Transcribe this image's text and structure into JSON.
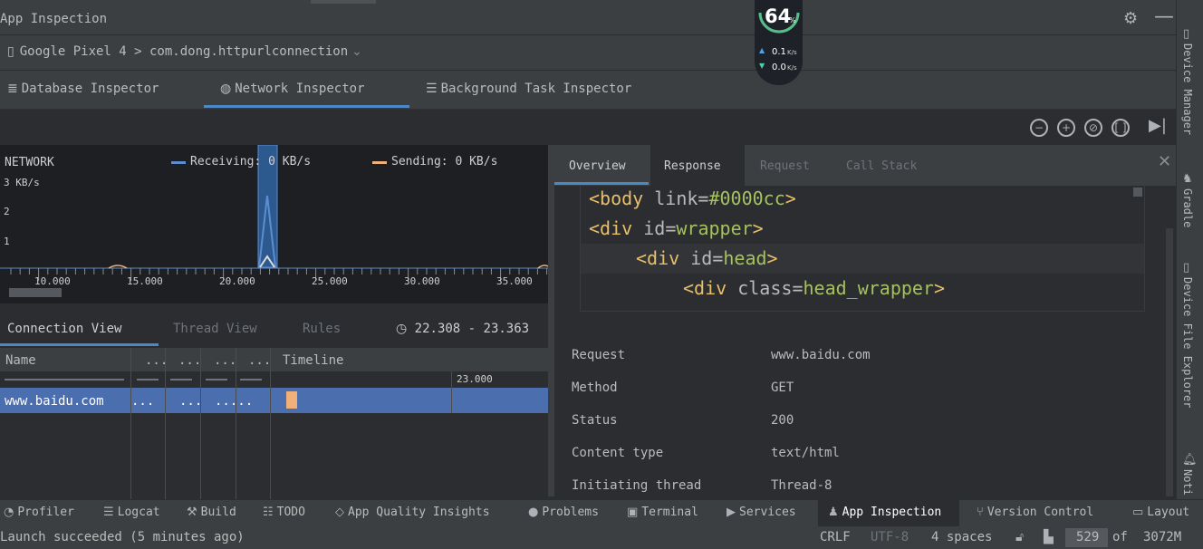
{
  "window": {
    "title": "App Inspection"
  },
  "device": {
    "path": "Google Pixel 4 > com.dong.httpurlconnection"
  },
  "inspector_tabs": [
    {
      "label": "Database Inspector",
      "icon": "database-icon"
    },
    {
      "label": "Network Inspector",
      "icon": "globe-icon"
    },
    {
      "label": "Background Task Inspector",
      "icon": "list-icon"
    }
  ],
  "net_meter": {
    "percent": "64",
    "unit": "%",
    "up": "0.1",
    "down": "0.0",
    "rate_unit": "K/s"
  },
  "graph": {
    "title": "NETWORK",
    "receiving": "Receiving: 0 KB/s",
    "sending": "Sending: 0 KB/s",
    "y_ticks": [
      "3 KB/s",
      "2",
      "1"
    ],
    "x_ticks": [
      "10.000",
      "15.000",
      "20.000",
      "25.000",
      "30.000",
      "35.000"
    ],
    "colors": {
      "receiving": "#5a8ed1",
      "sending": "#f0b07a",
      "selection": "#2d5a8e"
    }
  },
  "connection": {
    "tabs": [
      "Connection View",
      "Thread View",
      "Rules"
    ],
    "range": "22.308 - 23.363",
    "columns": [
      "Name",
      "...",
      "...",
      "...",
      "...",
      "Timeline"
    ],
    "ruler_label": "23.000",
    "rows": [
      {
        "name": "www.baidu.com",
        "c1": "...",
        "c2": "...",
        "c3": "....."
      }
    ]
  },
  "detail": {
    "tabs": [
      "Overview",
      "Response",
      "Request",
      "Call Stack"
    ],
    "code": {
      "l1": {
        "tag_open": "<body ",
        "attr": "link",
        "eq": "=",
        "val": "#0000cc",
        "close": ">"
      },
      "l2": {
        "tag_open": "<div ",
        "attr": "id",
        "eq": "=",
        "val": "wrapper",
        "close": ">"
      },
      "l3": {
        "tag_open": "<div ",
        "attr": "id",
        "eq": "=",
        "val": "head",
        "close": ">"
      },
      "l4": {
        "tag_open": "<div ",
        "attr": "class",
        "eq": "=",
        "val": "head_wrapper",
        "close": ">"
      }
    },
    "overview": [
      {
        "label": "Request",
        "value": "www.baidu.com"
      },
      {
        "label": "Method",
        "value": "GET"
      },
      {
        "label": "Status",
        "value": "200"
      },
      {
        "label": "Content type",
        "value": "text/html"
      },
      {
        "label": "Initiating thread",
        "value": "Thread-8"
      }
    ]
  },
  "bottom_tools": [
    {
      "label": "Profiler",
      "icon": "profiler-icon"
    },
    {
      "label": "Logcat",
      "icon": "logcat-icon"
    },
    {
      "label": "Build",
      "icon": "hammer-icon"
    },
    {
      "label": "TODO",
      "icon": "todo-icon"
    },
    {
      "label": "App Quality Insights",
      "icon": "diamond-icon"
    },
    {
      "label": "Problems",
      "icon": "problems-icon"
    },
    {
      "label": "Terminal",
      "icon": "terminal-icon"
    },
    {
      "label": "Services",
      "icon": "services-icon"
    },
    {
      "label": "App Inspection",
      "icon": "android-icon"
    },
    {
      "label": "Version Control",
      "icon": "vcs-icon"
    },
    {
      "label": "Layout",
      "icon": "layout-icon"
    }
  ],
  "status": {
    "message": "Launch succeeded (5 minutes ago)",
    "line_ending": "CRLF",
    "encoding": "UTF-8",
    "indent": "4 spaces",
    "memory_used": "529",
    "memory_of": "of",
    "memory_total": "3072M"
  },
  "right_rail": [
    "Device Manager",
    "Gradle",
    "Device File Explorer",
    "Notifications"
  ]
}
